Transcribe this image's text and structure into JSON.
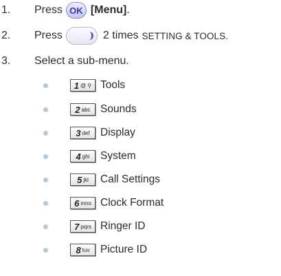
{
  "steps": [
    {
      "number": "1.",
      "pre": "Press",
      "icon": "ok-key-icon",
      "icon_text": "OK",
      "bold": "[Menu]",
      "post": "."
    },
    {
      "number": "2.",
      "pre": "Press",
      "icon": "nav-right-key-icon",
      "mid": "2 times",
      "caps": "SETTING & TOOLS."
    },
    {
      "number": "3.",
      "text": "Select a sub-menu."
    }
  ],
  "submenu": [
    {
      "digit": "1",
      "letters": "@ ⚲",
      "label": "Tools"
    },
    {
      "digit": "2",
      "letters": "abc",
      "label": "Sounds"
    },
    {
      "digit": "3",
      "letters": "def",
      "label": "Display"
    },
    {
      "digit": "4",
      "letters": "ghi",
      "label": "System"
    },
    {
      "digit": "5",
      "letters": "jkl",
      "label": "Call Settings"
    },
    {
      "digit": "6",
      "letters": "mno",
      "label": "Clock Format"
    },
    {
      "digit": "7",
      "letters": "pqrs",
      "label": "Ringer ID"
    },
    {
      "digit": "8",
      "letters": "tuv",
      "label": "Picture ID"
    }
  ],
  "colors": {
    "text": "#2b2b2b",
    "ok_key": "#3a38a8",
    "nav_arc": "#5a55c6",
    "bullet": "#b9c7d4"
  }
}
